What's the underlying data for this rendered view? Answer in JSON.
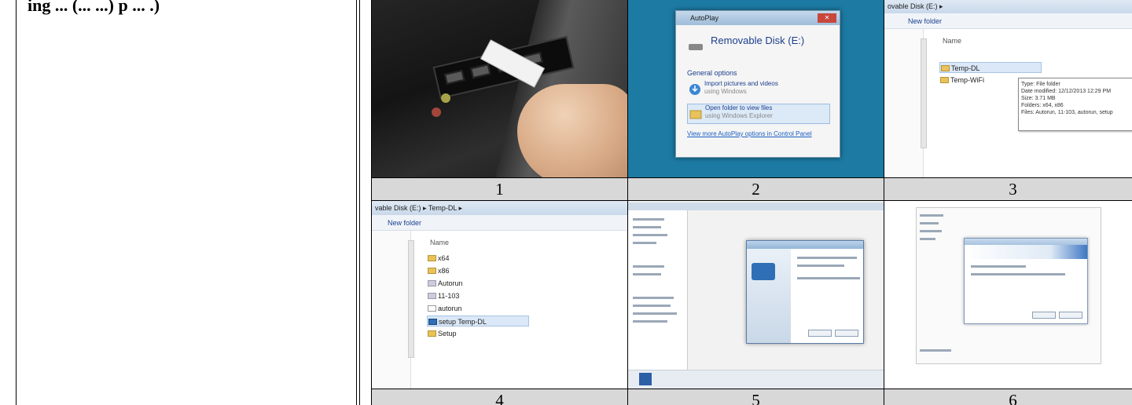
{
  "left_text": "ing ... (... ...) p ... .)",
  "steps": [
    {
      "label": "1",
      "name": "photo-usb-insert"
    },
    {
      "label": "2",
      "name": "autoplay-dialog"
    },
    {
      "label": "3",
      "name": "explorer-folder"
    },
    {
      "label": "4",
      "name": "explorer-subfolder"
    },
    {
      "label": "5",
      "name": "installer-dialog"
    },
    {
      "label": "6",
      "name": "setup-wizard"
    }
  ],
  "autoplay": {
    "title": "AutoPlay",
    "drive": "Removable Disk (E:)",
    "general": "General options",
    "opt1": "Import pictures and videos",
    "opt1_sub": "using Windows",
    "opt2": "Open folder to view files",
    "opt2_sub": "using Windows Explorer",
    "link": "View more AutoPlay options in Control Panel"
  },
  "explorer3": {
    "address": "ovable Disk (E:) ▸",
    "new_folder": "New folder",
    "name_header": "Name",
    "items": [
      "Temp-DL",
      "Temp-WiFi"
    ],
    "tooltip": [
      "Type: File folder",
      "Date modified: 12/12/2013 12:29 PM",
      "Size: 3.71 MB",
      "Folders: x64, x86",
      "Files: Autorun, 11-103, autorun, setup"
    ]
  },
  "explorer4": {
    "address": "vable Disk (E:) ▸ Temp-DL ▸",
    "new_folder": "New folder",
    "name_header": "Name",
    "items": [
      "x64",
      "x86",
      "Autorun",
      "11-103",
      "autorun",
      "setup Temp-DL",
      "Setup"
    ]
  }
}
